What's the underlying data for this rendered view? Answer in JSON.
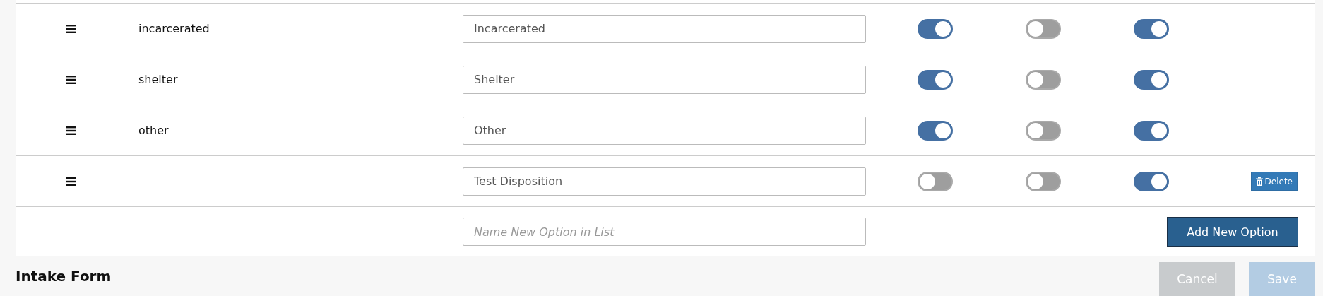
{
  "options": [
    {
      "name": "incarcerated",
      "label": "Incarcerated",
      "toggles": [
        {
          "on": true
        },
        {
          "on": false
        },
        {
          "on": true
        }
      ]
    },
    {
      "name": "shelter",
      "label": "Shelter",
      "toggles": [
        {
          "on": true
        },
        {
          "on": false
        },
        {
          "on": true
        }
      ]
    },
    {
      "name": "other",
      "label": "Other",
      "toggles": [
        {
          "on": true
        },
        {
          "on": false
        },
        {
          "on": true
        }
      ]
    },
    {
      "label": "Test Disposition",
      "toggles": [
        {
          "on": false
        },
        {
          "on": false
        },
        {
          "on": true
        }
      ],
      "delete": "Delete"
    }
  ],
  "new_option": {
    "placeholder": "Name New Option in List",
    "button": "Add New Option"
  },
  "footer": {
    "title": "Intake Form",
    "buttons": [
      {
        "label": "Cancel",
        "kind": "cancel",
        "disabled": true
      },
      {
        "label": "Save",
        "kind": "save",
        "disabled": true
      }
    ]
  }
}
